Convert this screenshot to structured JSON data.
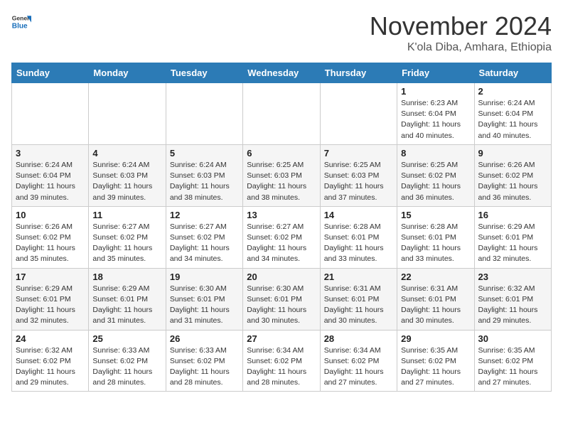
{
  "header": {
    "logo_general": "General",
    "logo_blue": "Blue",
    "month_title": "November 2024",
    "location": "K'ola Diba, Amhara, Ethiopia"
  },
  "weekdays": [
    "Sunday",
    "Monday",
    "Tuesday",
    "Wednesday",
    "Thursday",
    "Friday",
    "Saturday"
  ],
  "weeks": [
    [
      {
        "day": "",
        "detail": ""
      },
      {
        "day": "",
        "detail": ""
      },
      {
        "day": "",
        "detail": ""
      },
      {
        "day": "",
        "detail": ""
      },
      {
        "day": "",
        "detail": ""
      },
      {
        "day": "1",
        "detail": "Sunrise: 6:23 AM\nSunset: 6:04 PM\nDaylight: 11 hours\nand 40 minutes."
      },
      {
        "day": "2",
        "detail": "Sunrise: 6:24 AM\nSunset: 6:04 PM\nDaylight: 11 hours\nand 40 minutes."
      }
    ],
    [
      {
        "day": "3",
        "detail": "Sunrise: 6:24 AM\nSunset: 6:04 PM\nDaylight: 11 hours\nand 39 minutes."
      },
      {
        "day": "4",
        "detail": "Sunrise: 6:24 AM\nSunset: 6:03 PM\nDaylight: 11 hours\nand 39 minutes."
      },
      {
        "day": "5",
        "detail": "Sunrise: 6:24 AM\nSunset: 6:03 PM\nDaylight: 11 hours\nand 38 minutes."
      },
      {
        "day": "6",
        "detail": "Sunrise: 6:25 AM\nSunset: 6:03 PM\nDaylight: 11 hours\nand 38 minutes."
      },
      {
        "day": "7",
        "detail": "Sunrise: 6:25 AM\nSunset: 6:03 PM\nDaylight: 11 hours\nand 37 minutes."
      },
      {
        "day": "8",
        "detail": "Sunrise: 6:25 AM\nSunset: 6:02 PM\nDaylight: 11 hours\nand 36 minutes."
      },
      {
        "day": "9",
        "detail": "Sunrise: 6:26 AM\nSunset: 6:02 PM\nDaylight: 11 hours\nand 36 minutes."
      }
    ],
    [
      {
        "day": "10",
        "detail": "Sunrise: 6:26 AM\nSunset: 6:02 PM\nDaylight: 11 hours\nand 35 minutes."
      },
      {
        "day": "11",
        "detail": "Sunrise: 6:27 AM\nSunset: 6:02 PM\nDaylight: 11 hours\nand 35 minutes."
      },
      {
        "day": "12",
        "detail": "Sunrise: 6:27 AM\nSunset: 6:02 PM\nDaylight: 11 hours\nand 34 minutes."
      },
      {
        "day": "13",
        "detail": "Sunrise: 6:27 AM\nSunset: 6:02 PM\nDaylight: 11 hours\nand 34 minutes."
      },
      {
        "day": "14",
        "detail": "Sunrise: 6:28 AM\nSunset: 6:01 PM\nDaylight: 11 hours\nand 33 minutes."
      },
      {
        "day": "15",
        "detail": "Sunrise: 6:28 AM\nSunset: 6:01 PM\nDaylight: 11 hours\nand 33 minutes."
      },
      {
        "day": "16",
        "detail": "Sunrise: 6:29 AM\nSunset: 6:01 PM\nDaylight: 11 hours\nand 32 minutes."
      }
    ],
    [
      {
        "day": "17",
        "detail": "Sunrise: 6:29 AM\nSunset: 6:01 PM\nDaylight: 11 hours\nand 32 minutes."
      },
      {
        "day": "18",
        "detail": "Sunrise: 6:29 AM\nSunset: 6:01 PM\nDaylight: 11 hours\nand 31 minutes."
      },
      {
        "day": "19",
        "detail": "Sunrise: 6:30 AM\nSunset: 6:01 PM\nDaylight: 11 hours\nand 31 minutes."
      },
      {
        "day": "20",
        "detail": "Sunrise: 6:30 AM\nSunset: 6:01 PM\nDaylight: 11 hours\nand 30 minutes."
      },
      {
        "day": "21",
        "detail": "Sunrise: 6:31 AM\nSunset: 6:01 PM\nDaylight: 11 hours\nand 30 minutes."
      },
      {
        "day": "22",
        "detail": "Sunrise: 6:31 AM\nSunset: 6:01 PM\nDaylight: 11 hours\nand 30 minutes."
      },
      {
        "day": "23",
        "detail": "Sunrise: 6:32 AM\nSunset: 6:01 PM\nDaylight: 11 hours\nand 29 minutes."
      }
    ],
    [
      {
        "day": "24",
        "detail": "Sunrise: 6:32 AM\nSunset: 6:02 PM\nDaylight: 11 hours\nand 29 minutes."
      },
      {
        "day": "25",
        "detail": "Sunrise: 6:33 AM\nSunset: 6:02 PM\nDaylight: 11 hours\nand 28 minutes."
      },
      {
        "day": "26",
        "detail": "Sunrise: 6:33 AM\nSunset: 6:02 PM\nDaylight: 11 hours\nand 28 minutes."
      },
      {
        "day": "27",
        "detail": "Sunrise: 6:34 AM\nSunset: 6:02 PM\nDaylight: 11 hours\nand 28 minutes."
      },
      {
        "day": "28",
        "detail": "Sunrise: 6:34 AM\nSunset: 6:02 PM\nDaylight: 11 hours\nand 27 minutes."
      },
      {
        "day": "29",
        "detail": "Sunrise: 6:35 AM\nSunset: 6:02 PM\nDaylight: 11 hours\nand 27 minutes."
      },
      {
        "day": "30",
        "detail": "Sunrise: 6:35 AM\nSunset: 6:02 PM\nDaylight: 11 hours\nand 27 minutes."
      }
    ]
  ]
}
